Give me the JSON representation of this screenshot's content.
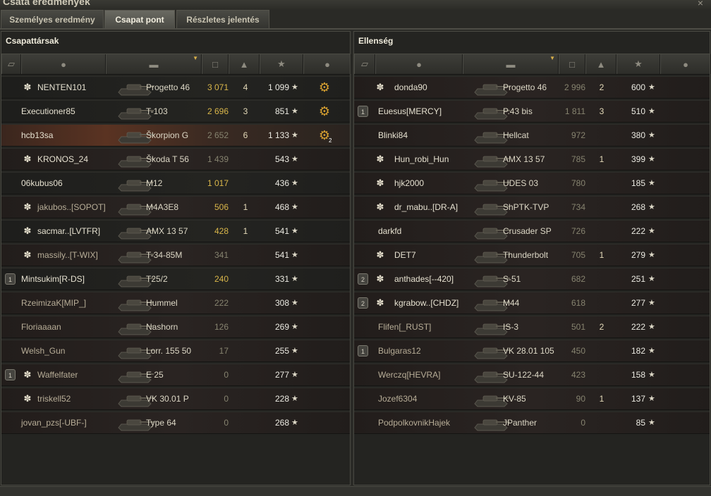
{
  "window": {
    "title": "Csata eredmények",
    "close_glyph": "×"
  },
  "tabs": [
    {
      "label": "Személyes eredmény",
      "active": false
    },
    {
      "label": "Csapat pont",
      "active": true
    },
    {
      "label": "Részletes jelentés",
      "active": false
    }
  ],
  "left": {
    "title": "Csapattársak",
    "players": [
      {
        "name": "NENTEN101",
        "clan_icon": "clan-emblem-icon",
        "tank": "Progetto 46",
        "damage": "3 071",
        "kills": "4",
        "xp": "1 099",
        "medal": "medal-icon",
        "style": ""
      },
      {
        "name": "Executioner85",
        "tank": "T-103",
        "damage": "2 696",
        "kills": "3",
        "xp": "851",
        "medal": "medal-icon",
        "style": ""
      },
      {
        "name": "hcb13sa",
        "tank": "Škorpion G",
        "damage": "2 652",
        "kills": "6",
        "xp": "1 133",
        "medal": "medal-icon",
        "medal_count": "2",
        "style": "hl"
      },
      {
        "name": "KRONOS_24",
        "clan_icon": "clan-emblem-icon",
        "tank": "Škoda T 56",
        "damage": "1 439",
        "kills": "",
        "xp": "543",
        "style": "alt"
      },
      {
        "name": "06kubus06",
        "tank": "M12",
        "damage": "1 017",
        "kills": "",
        "xp": "436",
        "style": ""
      },
      {
        "name": "jakubos..[SOPOT]",
        "clan_icon": "clan-emblem-icon",
        "tank": "M4A3E8",
        "damage": "506",
        "kills": "1",
        "xp": "468",
        "style": "alt"
      },
      {
        "name": "sacmar..[LVTFR]",
        "clan_icon": "clan-emblem-icon",
        "tank": "AMX 13 57",
        "damage": "428",
        "kills": "1",
        "xp": "541",
        "style": ""
      },
      {
        "name": "massily..[T-WIX]",
        "clan_icon": "clan-emblem-icon",
        "tank": "T-34-85M",
        "damage": "341",
        "kills": "",
        "xp": "541",
        "style": "alt"
      },
      {
        "name": "Mintsukim[R-DS]",
        "platoon": "1",
        "tank": "T25/2",
        "damage": "240",
        "kills": "",
        "xp": "331",
        "style": ""
      },
      {
        "name": "RzeimizaK[MIP_]",
        "tank": "Hummel",
        "damage": "222",
        "kills": "",
        "xp": "308",
        "style": "alt"
      },
      {
        "name": "Floriaaaan",
        "tank": "Nashorn",
        "damage": "126",
        "kills": "",
        "xp": "269",
        "style": "alt"
      },
      {
        "name": "Welsh_Gun",
        "tank": "Lorr. 155 50",
        "damage": "17",
        "kills": "",
        "xp": "255",
        "style": "alt"
      },
      {
        "name": "Waffelfater",
        "platoon": "1",
        "clan_icon": "clan-emblem-icon",
        "tank": "E 25",
        "damage": "0",
        "kills": "",
        "xp": "277",
        "style": "alt"
      },
      {
        "name": "triskell52",
        "clan_icon": "clan-emblem-icon",
        "tank": "VK 30.01 P",
        "damage": "0",
        "kills": "",
        "xp": "228",
        "style": "alt"
      },
      {
        "name": "jovan_pzs[-UBF-]",
        "tank": "Type 64",
        "damage": "0",
        "kills": "",
        "xp": "268",
        "style": "alt"
      }
    ]
  },
  "right": {
    "title": "Ellenség",
    "players": [
      {
        "name": "donda90",
        "clan_icon": "clan-emblem-icon",
        "tank": "Progetto 46",
        "damage": "2 996",
        "kills": "2",
        "xp": "600",
        "style": "alt"
      },
      {
        "name": "Euesus[MERCY]",
        "platoon": "1",
        "tank": "P.43 bis",
        "damage": "1 811",
        "kills": "3",
        "xp": "510",
        "style": "alt"
      },
      {
        "name": "Blinki84",
        "tank": "Hellcat",
        "damage": "972",
        "kills": "",
        "xp": "380",
        "style": "alt"
      },
      {
        "name": "Hun_robi_Hun",
        "clan_icon": "clan-emblem-icon",
        "tank": "AMX 13 57",
        "damage": "785",
        "kills": "1",
        "xp": "399",
        "style": "alt"
      },
      {
        "name": "hjk2000",
        "clan_icon": "clan-emblem-icon",
        "tank": "UDES 03",
        "damage": "780",
        "kills": "",
        "xp": "185",
        "style": "alt"
      },
      {
        "name": "dr_mabu..[DR-A]",
        "clan_icon": "clan-emblem-icon",
        "tank": "ShPTK-TVP",
        "damage": "734",
        "kills": "",
        "xp": "268",
        "style": "alt"
      },
      {
        "name": "darkfd",
        "tank": "Crusader SP",
        "damage": "726",
        "kills": "",
        "xp": "222",
        "style": "alt"
      },
      {
        "name": "DET7",
        "clan_icon": "clan-emblem-icon",
        "tank": "Thunderbolt",
        "damage": "705",
        "kills": "1",
        "xp": "279",
        "style": "alt"
      },
      {
        "name": "anthades[--420]",
        "platoon": "2",
        "clan_icon": "clan-emblem-icon",
        "tank": "S-51",
        "damage": "682",
        "kills": "",
        "xp": "251",
        "style": "alt"
      },
      {
        "name": "kgrabow..[CHDZ]",
        "platoon": "2",
        "clan_icon": "clan-emblem-icon",
        "tank": "M44",
        "damage": "618",
        "kills": "",
        "xp": "277",
        "style": "alt"
      },
      {
        "name": "Flifen[_RUST]",
        "tank": "IS-3",
        "damage": "501",
        "kills": "2",
        "xp": "222",
        "style": "alt"
      },
      {
        "name": "Bulgaras12",
        "platoon": "1",
        "tank": "VK 28.01 105",
        "damage": "450",
        "kills": "",
        "xp": "182",
        "style": "alt"
      },
      {
        "name": "Werczq[HEVRA]",
        "tank": "SU-122-44",
        "damage": "423",
        "kills": "",
        "xp": "158",
        "style": "alt"
      },
      {
        "name": "Jozef6304",
        "tank": "KV-85",
        "damage": "90",
        "kills": "1",
        "xp": "137",
        "style": "alt"
      },
      {
        "name": "PodpolkovnikHajek",
        "tank": "JPanther",
        "damage": "0",
        "kills": "",
        "xp": "85",
        "style": "alt"
      }
    ]
  },
  "header_icons": [
    "squad-icon",
    "player-icon",
    "tank-icon",
    "damage-icon",
    "kills-icon",
    "star-icon",
    "medal-icon"
  ],
  "colors": {
    "damage_high": "#d9b64a",
    "damage_low": "#86836f",
    "highlight_row": "#5a3322"
  }
}
